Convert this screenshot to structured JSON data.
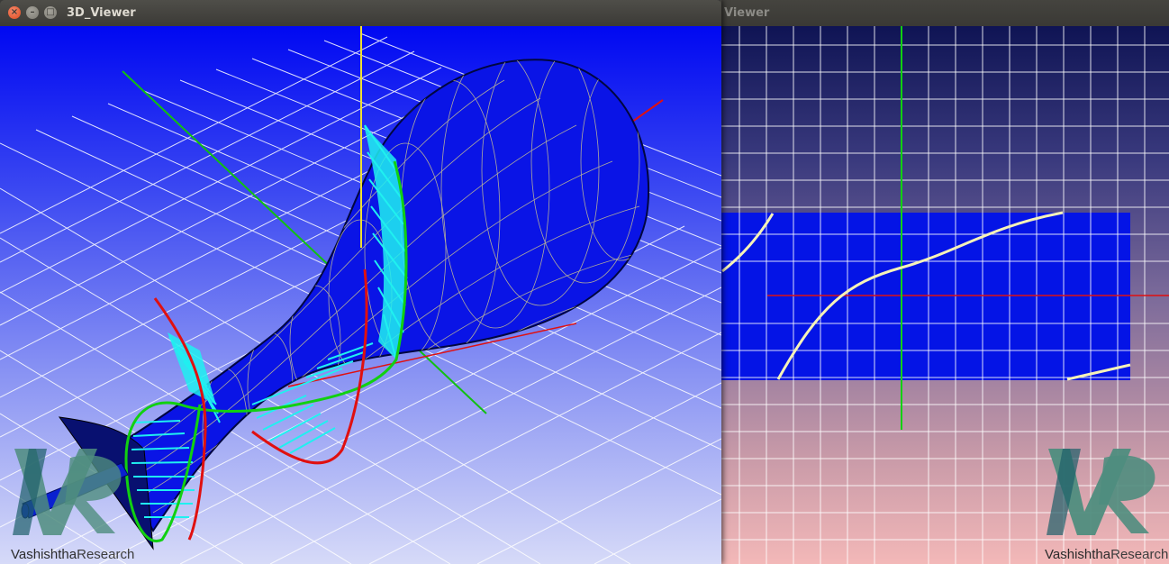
{
  "windows": {
    "viewer3d": {
      "title": "3D_Viewer"
    },
    "viewer2d": {
      "title": "Viewer"
    }
  },
  "logo": {
    "part1": "Vashishtha",
    "part2": "Research"
  },
  "colors": {
    "mesh_surface": "#0a14e6",
    "axis_x": "#e01010",
    "axis_y": "#11d011",
    "axis_z": "#f0e030",
    "helix_surface": "#20f0f0",
    "curve": "#f6f2b8",
    "grid": "#ffffff"
  }
}
